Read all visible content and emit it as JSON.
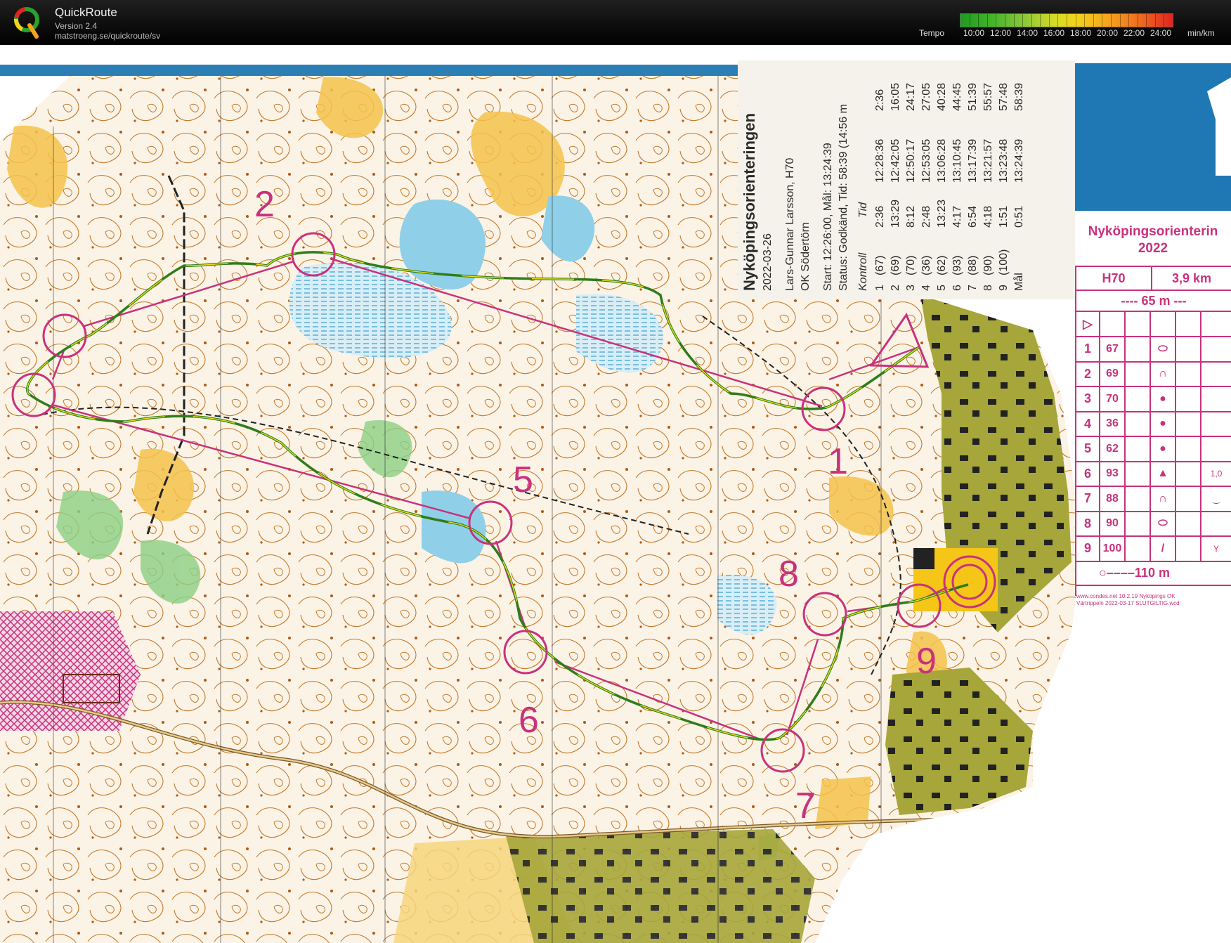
{
  "header": {
    "app_name": "QuickRoute",
    "version": "Version 2.4",
    "url": "matstroeng.se/quickroute/sv",
    "tempo_label": "Tempo",
    "tempo_ticks": [
      "10:00",
      "12:00",
      "14:00",
      "16:00",
      "18:00",
      "20:00",
      "22:00",
      "24:00"
    ],
    "tempo_unit": "min/km"
  },
  "event_label": {
    "title": "Nyköpingsorienteringen",
    "date": "2022-03-26",
    "runner": "Lars-Gunnar Larsson, H70",
    "club": "OK Södertörn",
    "start_line": "Start: 12:26:00, Mål: 13:24:39",
    "status_line": "Status: Godkänd, Tid: 58:39 (14:56 m",
    "col_kontroll": "Kontroll",
    "col_tid": "Tid",
    "splits": [
      {
        "nr": "1",
        "code": "(67)",
        "leg": "2:36",
        "clock": "12:28:36",
        "total": "2:36"
      },
      {
        "nr": "2",
        "code": "(69)",
        "leg": "13:29",
        "clock": "12:42:05",
        "total": "16:05"
      },
      {
        "nr": "3",
        "code": "(70)",
        "leg": "8:12",
        "clock": "12:50:17",
        "total": "24:17"
      },
      {
        "nr": "4",
        "code": "(36)",
        "leg": "2:48",
        "clock": "12:53:05",
        "total": "27:05"
      },
      {
        "nr": "5",
        "code": "(62)",
        "leg": "13:23",
        "clock": "13:06:28",
        "total": "40:28"
      },
      {
        "nr": "6",
        "code": "(93)",
        "leg": "4:17",
        "clock": "13:10:45",
        "total": "44:45"
      },
      {
        "nr": "7",
        "code": "(88)",
        "leg": "6:54",
        "clock": "13:17:39",
        "total": "51:39"
      },
      {
        "nr": "8",
        "code": "(90)",
        "leg": "4:18",
        "clock": "13:21:57",
        "total": "55:57"
      },
      {
        "nr": "9",
        "code": "(100)",
        "leg": "1:51",
        "clock": "13:23:48",
        "total": "57:48"
      },
      {
        "nr": "Mål",
        "code": "",
        "leg": "0:51",
        "clock": "13:24:39",
        "total": "58:39"
      }
    ]
  },
  "control_description": {
    "title_line1": "Nyköpingsorienterin",
    "title_line2": "2022",
    "class": "H70",
    "length": "3,9 km",
    "climb": "---- 65 m ---",
    "rows": [
      {
        "nr": "1",
        "code": "67",
        "sym": "⬭",
        "extra": ""
      },
      {
        "nr": "2",
        "code": "69",
        "sym": "∩",
        "extra": ""
      },
      {
        "nr": "3",
        "code": "70",
        "sym": "●",
        "extra": ""
      },
      {
        "nr": "4",
        "code": "36",
        "sym": "●",
        "extra": ""
      },
      {
        "nr": "5",
        "code": "62",
        "sym": "●",
        "extra": ""
      },
      {
        "nr": "6",
        "code": "93",
        "sym": "▲",
        "extra": "1,0"
      },
      {
        "nr": "7",
        "code": "88",
        "sym": "∩",
        "extra": "‿"
      },
      {
        "nr": "8",
        "code": "90",
        "sym": "⬭",
        "extra": ""
      },
      {
        "nr": "9",
        "code": "100",
        "sym": "/",
        "extra": "Y"
      }
    ],
    "finish_line": "110 m",
    "footer_line1": "www.condes.net 10.2.19 Nyköpings OK",
    "footer_line2": "Värtrippeln 2022-03-17 SLUTGILTIG.wcd"
  },
  "course": {
    "control_numbers": [
      "1",
      "2",
      "5",
      "6",
      "7",
      "8",
      "9"
    ],
    "colors": {
      "course": "#c8327c",
      "route_slow": "#2e7d1a",
      "route_fast": "#e5e01a",
      "water": "#9cd4ea",
      "open_land": "#f4c24a",
      "urban": "#9aa02a",
      "contour": "#b86a1e"
    }
  }
}
